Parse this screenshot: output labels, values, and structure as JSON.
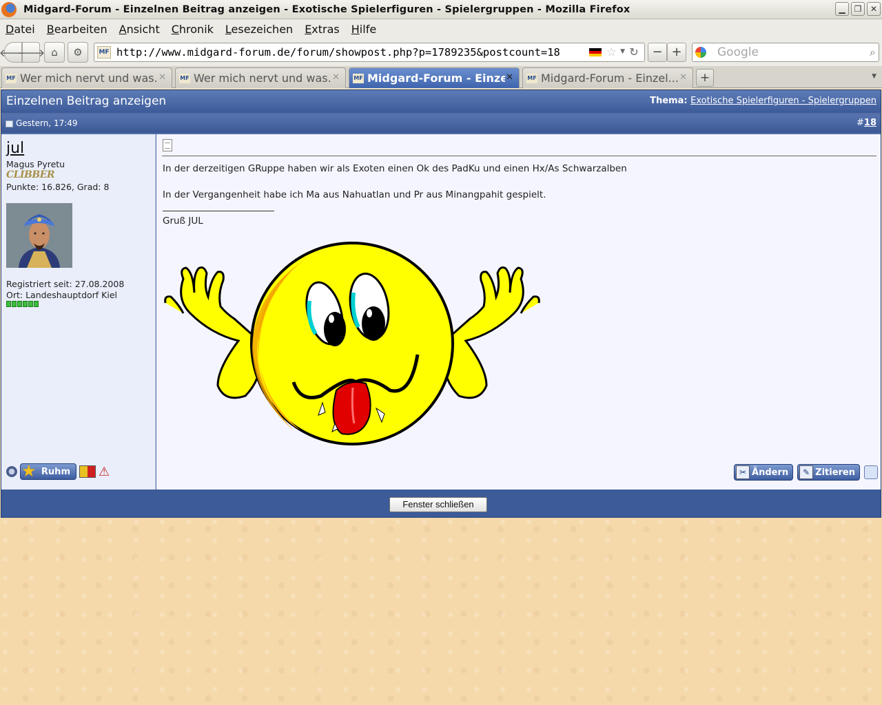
{
  "window": {
    "title": "Midgard-Forum - Einzelnen Beitrag anzeigen - Exotische Spielerfiguren - Spielergruppen - Mozilla Firefox"
  },
  "menu": {
    "items": [
      {
        "u": "D",
        "rest": "atei"
      },
      {
        "u": "B",
        "rest": "earbeiten"
      },
      {
        "u": "A",
        "rest": "nsicht"
      },
      {
        "u": "C",
        "rest": "hronik"
      },
      {
        "u": "L",
        "rest": "esezeichen"
      },
      {
        "u": "E",
        "rest": "xtras"
      },
      {
        "u": "H",
        "rest": "ilfe"
      }
    ]
  },
  "nav": {
    "url": "http://www.midgard-forum.de/forum/showpost.php?p=1789235&postcount=18",
    "site_icon": "MF",
    "search_placeholder": "Google"
  },
  "tabs": [
    {
      "label": "Wer mich nervt und was...",
      "active": false
    },
    {
      "label": "Wer mich nervt und was...",
      "active": false
    },
    {
      "label": "Midgard-Forum - Einze...",
      "active": true
    },
    {
      "label": "Midgard-Forum - Einzel...",
      "active": false
    }
  ],
  "page": {
    "header_title": "Einzelnen Beitrag anzeigen",
    "topic_label": "Thema:",
    "topic_link": "Exotische Spielerfiguren - Spielergruppen",
    "post_date": "Gestern, 17:49",
    "post_number_prefix": "#",
    "post_number": "18"
  },
  "user": {
    "name": "jul",
    "title": "Magus Pyretu",
    "rank_image_text": "CLIBBER",
    "points": "Punkte: 16.826, Grad: 8",
    "registered": "Registriert seit: 27.08.2008",
    "location": "Ort: Landeshauptdorf Kiel",
    "reputation_pips": 6,
    "ruhm_label": "Ruhm"
  },
  "post": {
    "line1": "In der derzeitigen GRuppe haben wir als Exoten einen Ok des PadKu und einen Hx/As Schwarzalben",
    "line2": "In der Vergangenheit habe ich Ma aus Nahuatlan und Pr aus Minangpahit gespielt.",
    "signature": "Gruß JUL",
    "edit_label": "Ändern",
    "quote_label": "Zitieren"
  },
  "footer": {
    "close_button": "Fenster schließen"
  },
  "colors": {
    "header_blue": "#3d5b98",
    "post_bg": "#f5f5ff",
    "user_bg": "#e9eefa",
    "page_bg": "#f5d9ab"
  }
}
